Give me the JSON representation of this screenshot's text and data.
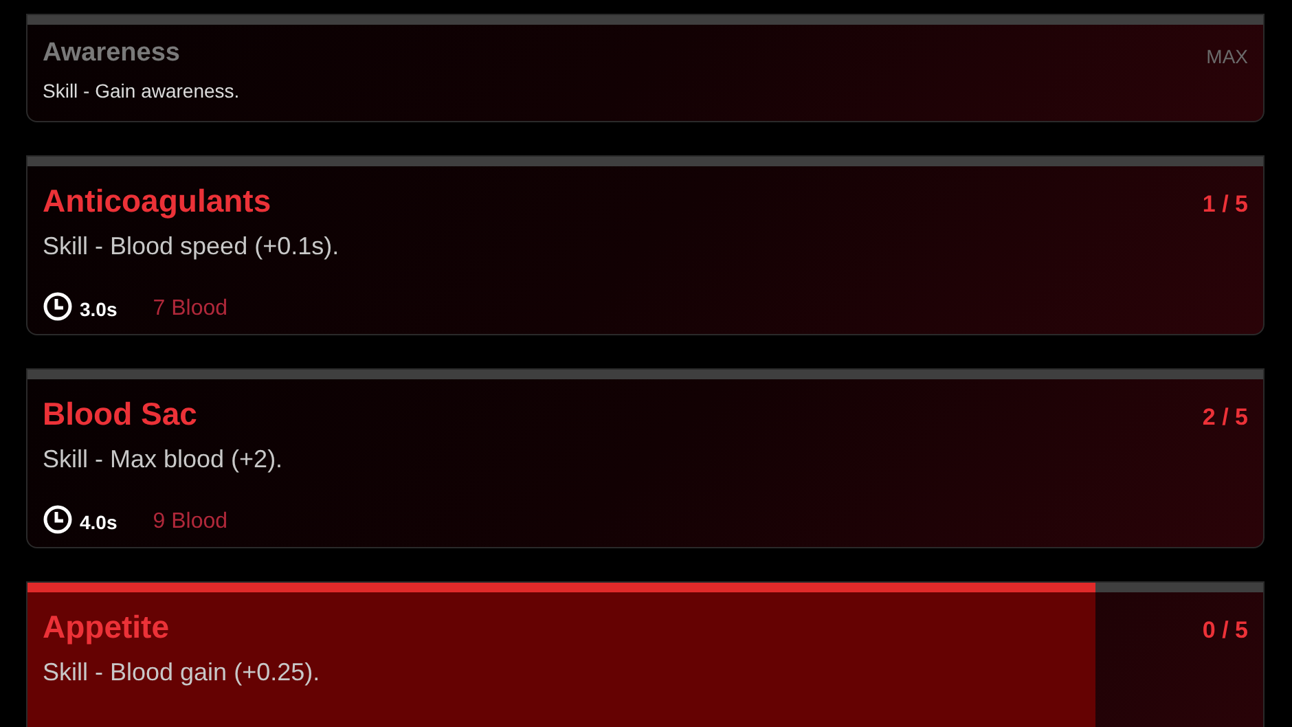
{
  "skills": [
    {
      "name": "Awareness",
      "rank": "MAX",
      "description": "Skill - Gain awareness.",
      "maxed": true
    },
    {
      "name": "Anticoagulants",
      "rank": "1 / 5",
      "description": "Skill - Blood speed (+0.1s).",
      "maxed": false,
      "time": "3.0s",
      "cost": "7 Blood"
    },
    {
      "name": "Blood Sac",
      "rank": "2 / 5",
      "description": "Skill - Max blood (+2).",
      "maxed": false,
      "time": "4.0s",
      "cost": "9 Blood"
    },
    {
      "name": "Appetite",
      "rank": "0 / 5",
      "description": "Skill - Blood gain (+0.25).",
      "maxed": false,
      "level": 0.864
    }
  ]
}
